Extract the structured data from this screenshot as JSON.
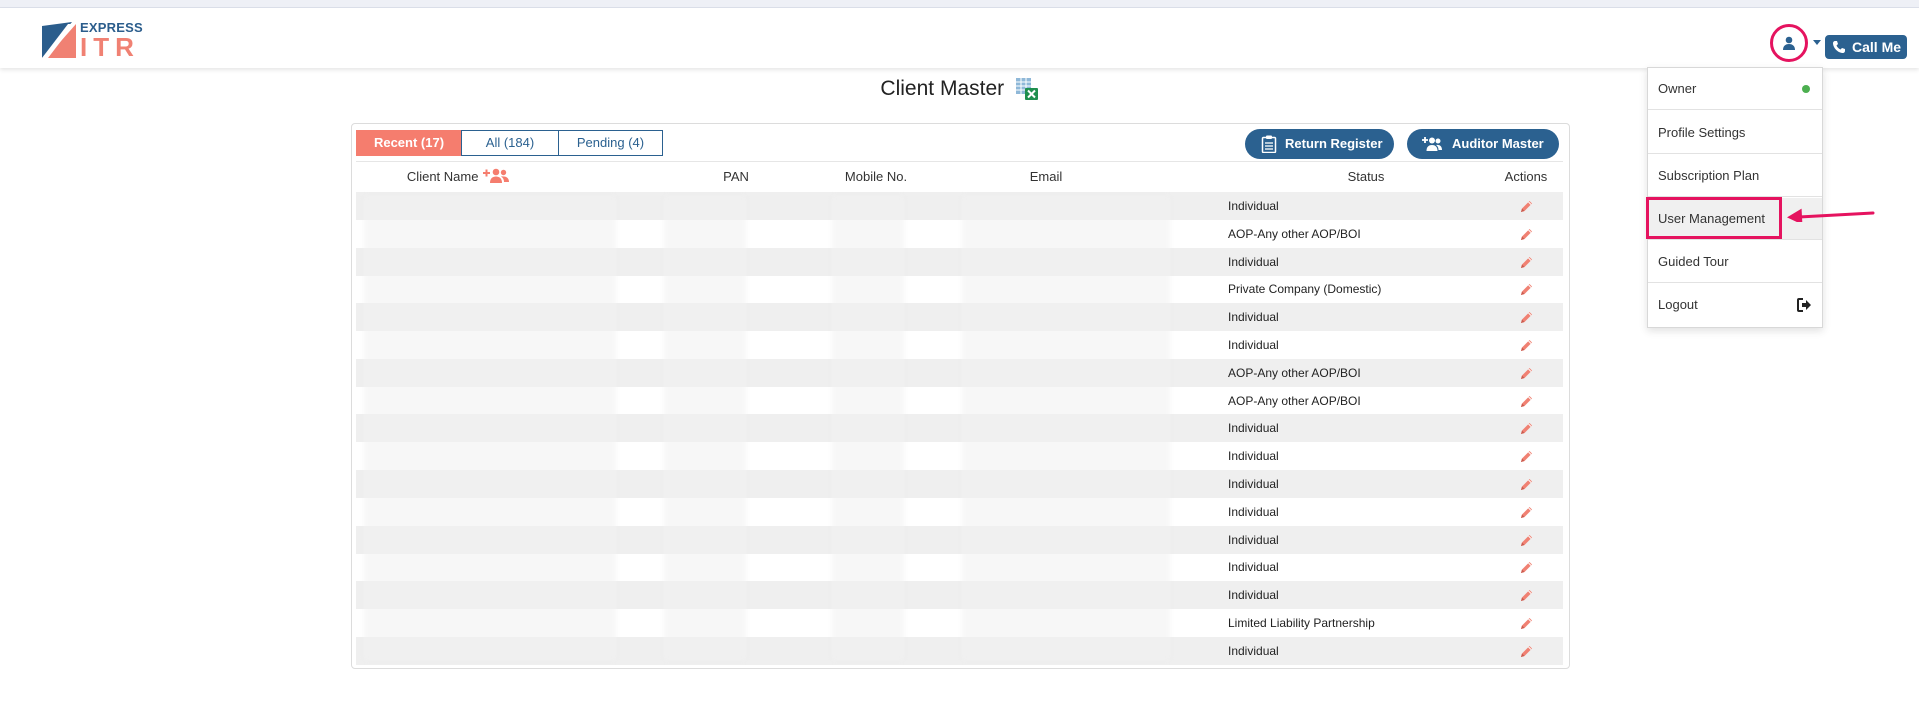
{
  "brand": {
    "line1": "EXPRESS",
    "line2": "ITR"
  },
  "header": {
    "call_me": "Call Me"
  },
  "page": {
    "title": "Client Master"
  },
  "tabs": [
    {
      "label": "Recent (17)",
      "active": true
    },
    {
      "label": "All (184)",
      "active": false
    },
    {
      "label": "Pending (4)",
      "active": false
    }
  ],
  "actions": {
    "return_register": "Return Register",
    "auditor_master": "Auditor Master"
  },
  "table": {
    "columns": [
      "Client Name",
      "PAN",
      "Mobile No.",
      "Email",
      "Status",
      "Actions"
    ],
    "rows": [
      {
        "status": "Individual"
      },
      {
        "status": "AOP-Any other AOP/BOI"
      },
      {
        "status": "Individual"
      },
      {
        "status": "Private Company (Domestic)"
      },
      {
        "status": "Individual"
      },
      {
        "status": "Individual"
      },
      {
        "status": "AOP-Any other AOP/BOI"
      },
      {
        "status": "AOP-Any other AOP/BOI"
      },
      {
        "status": "Individual"
      },
      {
        "status": "Individual"
      },
      {
        "status": "Individual"
      },
      {
        "status": "Individual"
      },
      {
        "status": "Individual"
      },
      {
        "status": "Individual"
      },
      {
        "status": "Individual"
      },
      {
        "status": "Limited Liability Partnership"
      },
      {
        "status": "Individual"
      }
    ]
  },
  "user_menu": {
    "items": [
      {
        "label": "Owner"
      },
      {
        "label": "Profile Settings"
      },
      {
        "label": "Subscription Plan"
      },
      {
        "label": "User Management"
      },
      {
        "label": "Guided Tour"
      },
      {
        "label": "Logout"
      }
    ]
  },
  "colors": {
    "primary": "#2b6190",
    "accent": "#f57d6e",
    "highlight": "#e5135f",
    "online": "#4caf50"
  }
}
